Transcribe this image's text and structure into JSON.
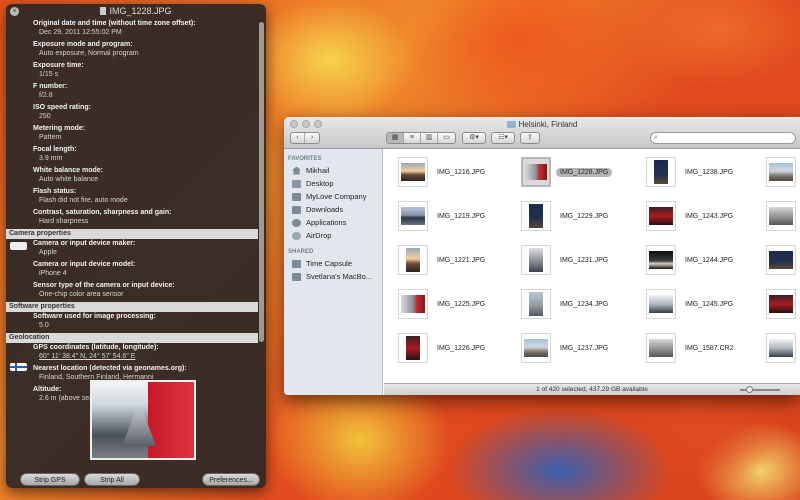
{
  "inspector": {
    "title": "IMG_1228.JPG",
    "fields_top": [
      {
        "label": "Original date and time (without time zone offset):",
        "value": "Dec 29, 2011 12:55:02 PM"
      },
      {
        "label": "Exposure mode and program:",
        "value": "Auto exposure, Normal program"
      },
      {
        "label": "Exposure time:",
        "value": "1/15 s"
      },
      {
        "label": "F number:",
        "value": "f/2.8"
      },
      {
        "label": "ISO speed rating:",
        "value": "250"
      },
      {
        "label": "Metering mode:",
        "value": "Pattern"
      },
      {
        "label": "Focal length:",
        "value": "3.9 mm"
      },
      {
        "label": "White balance mode:",
        "value": "Auto white balance"
      },
      {
        "label": "Flash status:",
        "value": "Flash did not fire, auto mode"
      },
      {
        "label": "Contrast, saturation, sharpness and gain:",
        "value": "Hard sharpness"
      }
    ],
    "section_camera": "Camera properties",
    "camera_fields": [
      {
        "label": "Camera or input device maker:",
        "value": "Apple"
      },
      {
        "label": "Camera or input device model:",
        "value": "iPhone 4"
      },
      {
        "label": "Sensor type of the camera or input device:",
        "value": "One-chip color area sensor"
      }
    ],
    "section_software": "Software properties",
    "software_fields": [
      {
        "label": "Software used for image processing:",
        "value": "5.0"
      }
    ],
    "section_geo": "Geolocation",
    "geo_fields": [
      {
        "label": "GPS coordinates (latitude, longitude):",
        "value": "60° 11' 38.4\" N, 24° 57' 54.6\" E"
      },
      {
        "label": "Nearest location (detected via geonames.org):",
        "value": "Finland, Southern Finland, Hermanni"
      },
      {
        "label": "Altitude:",
        "value": "2.6 m (above sea level)"
      }
    ],
    "buttons": {
      "strip_gps": "Strip GPS",
      "strip_all": "Strip All",
      "preferences": "Preferences..."
    }
  },
  "finder": {
    "title": "Helsinki, Finland",
    "sidebar": {
      "favorites_header": "FAVORITES",
      "favorites": [
        "Mikhail",
        "Desktop",
        "MyLove Company",
        "Downloads",
        "Applications",
        "AirDrop"
      ],
      "shared_header": "SHARED",
      "shared": [
        "Time Capsule",
        "Svetlana's MacBo..."
      ]
    },
    "files": [
      [
        "IMG_1216.JPG",
        "IMG_1228.JPG",
        "IMG_1238.JPG"
      ],
      [
        "IMG_1219.JPG",
        "IMG_1229.JPG",
        "IMG_1243.JPG"
      ],
      [
        "IMG_1221.JPG",
        "IMG_1231.JPG",
        "IMG_1244.JPG"
      ],
      [
        "IMG_1225.JPG",
        "IMG_1234.JPG",
        "IMG_1245.JPG"
      ],
      [
        "IMG_1226.JPG",
        "IMG_1237.JPG",
        "IMG_1587.CR2"
      ]
    ],
    "status": "1 of 420 selected, 437.29 GB available"
  }
}
